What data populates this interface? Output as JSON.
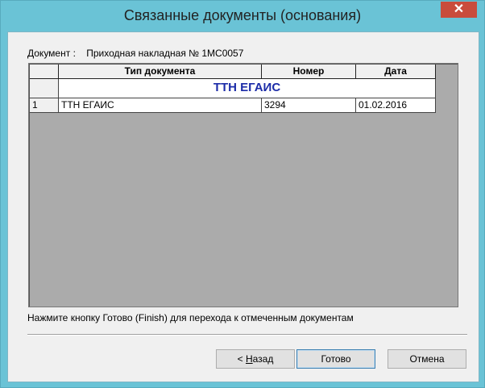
{
  "window": {
    "title": "Связанные документы (основания)",
    "close_glyph": "✕"
  },
  "document": {
    "label": "Документ :",
    "value": "Приходная накладная № 1МС0057"
  },
  "table": {
    "columns": [
      "",
      "Тип документа",
      "Номер",
      "Дата"
    ],
    "group": {
      "indicator": "",
      "title": "ТТН ЕГАИС"
    },
    "rows": [
      {
        "num": "1",
        "type": "ТТН ЕГАИС",
        "number": "3294",
        "date": "01.02.2016"
      }
    ]
  },
  "hint": "Нажмите кнопку Готово (Finish) для перехода к отмеченным документам",
  "buttons": {
    "back_prefix": "< ",
    "back_mnemonic": "Н",
    "back_rest": "азад",
    "done": "Готово",
    "cancel": "Отмена"
  },
  "colors": {
    "titlebar": "#6ac3d6",
    "close": "#c94c3c",
    "group_title": "#1c2ca8"
  }
}
